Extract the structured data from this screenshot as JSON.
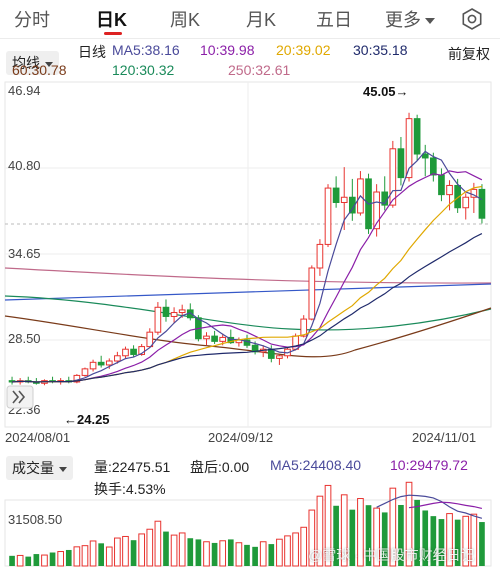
{
  "tabs": [
    {
      "label": "分时",
      "active": false
    },
    {
      "label": "日K",
      "active": true
    },
    {
      "label": "周K",
      "active": false
    },
    {
      "label": "月K",
      "active": false
    },
    {
      "label": "五日",
      "active": false
    },
    {
      "label": "更多",
      "active": false
    }
  ],
  "header": {
    "settings_icon": "settings-gear-icon",
    "indicator_select": "均线",
    "line_type": "日线",
    "adjust_mode": "前复权"
  },
  "moving_averages": [
    {
      "label": "MA5:38.16",
      "color": "#4a4a9a"
    },
    {
      "label": "10:39.98",
      "color": "#8b1fa8"
    },
    {
      "label": "20:39.02",
      "color": "#e0a800"
    },
    {
      "label": "30:35.18",
      "color": "#1f2a6b"
    },
    {
      "label": "60:30.78",
      "color": "#7a3b1a"
    },
    {
      "label": "120:30.32",
      "color": "#1a8a5a"
    },
    {
      "label": "250:32.61",
      "color": "#c06a8a"
    }
  ],
  "price_axis": {
    "ticks": [
      "46.94",
      "40.80",
      "34.65",
      "28.50",
      "22.36"
    ],
    "high_marker": "45.05→",
    "low_marker": "←24.25"
  },
  "date_axis": [
    "2024/08/01",
    "2024/09/12",
    "2024/11/01"
  ],
  "volume_panel": {
    "indicator_select": "成交量",
    "volume": "量:22475.51",
    "after_hours": "盘后:0.00",
    "ma5": "MA5:24408.40",
    "ma10": "10:29479.72",
    "turnover": "换手:4.53%",
    "axis_label": "31508.50"
  },
  "watermark": "@雪球 · 中国股市财经日记",
  "colors": {
    "up": "#e8332f",
    "down": "#1f9a3a",
    "grid": "#e6e6e6",
    "accent": "#d22222"
  },
  "chart_data": {
    "type": "candlestick",
    "ylim": [
      22.36,
      46.94
    ],
    "candles_ohlc": [
      [
        24.6,
        24.9,
        24.3,
        24.5
      ],
      [
        24.5,
        24.8,
        24.3,
        24.6
      ],
      [
        24.6,
        24.9,
        24.4,
        24.5
      ],
      [
        24.5,
        24.8,
        24.3,
        24.4
      ],
      [
        24.4,
        24.7,
        24.25,
        24.6
      ],
      [
        24.6,
        24.9,
        24.4,
        24.5
      ],
      [
        24.5,
        24.8,
        24.3,
        24.6
      ],
      [
        24.6,
        24.9,
        24.4,
        24.5
      ],
      [
        24.5,
        25.1,
        24.4,
        25.0
      ],
      [
        25.0,
        25.6,
        24.9,
        25.5
      ],
      [
        25.5,
        26.2,
        25.3,
        26.0
      ],
      [
        26.0,
        26.5,
        25.6,
        25.8
      ],
      [
        25.8,
        26.3,
        25.5,
        26.1
      ],
      [
        26.1,
        26.8,
        25.9,
        26.5
      ],
      [
        26.5,
        27.2,
        26.3,
        27.0
      ],
      [
        27.0,
        27.3,
        26.4,
        26.6
      ],
      [
        26.6,
        27.4,
        26.5,
        27.2
      ],
      [
        27.2,
        28.6,
        27.1,
        28.3
      ],
      [
        28.3,
        30.6,
        28.1,
        30.2
      ],
      [
        30.2,
        30.8,
        29.1,
        29.5
      ],
      [
        29.5,
        30.2,
        29.0,
        29.8
      ],
      [
        29.8,
        30.4,
        29.4,
        30.0
      ],
      [
        30.0,
        30.5,
        29.2,
        29.4
      ],
      [
        29.4,
        29.6,
        27.6,
        27.8
      ],
      [
        27.8,
        28.3,
        27.3,
        28.0
      ],
      [
        28.0,
        28.4,
        27.4,
        27.6
      ],
      [
        27.6,
        28.2,
        27.3,
        27.9
      ],
      [
        27.9,
        28.5,
        27.4,
        27.5
      ],
      [
        27.5,
        27.9,
        27.2,
        27.7
      ],
      [
        27.7,
        28.1,
        27.1,
        27.3
      ],
      [
        27.3,
        27.6,
        26.6,
        26.8
      ],
      [
        26.8,
        27.3,
        26.4,
        27.0
      ],
      [
        27.0,
        27.3,
        26.0,
        26.3
      ],
      [
        26.3,
        26.6,
        25.8,
        26.5
      ],
      [
        26.5,
        27.2,
        26.3,
        27.0
      ],
      [
        27.0,
        28.2,
        26.9,
        28.0
      ],
      [
        28.0,
        29.6,
        27.9,
        29.3
      ],
      [
        29.3,
        33.4,
        29.2,
        33.2
      ],
      [
        33.2,
        35.4,
        32.6,
        35.0
      ],
      [
        35.0,
        39.6,
        34.8,
        39.3
      ],
      [
        39.3,
        40.2,
        37.8,
        38.2
      ],
      [
        38.2,
        40.9,
        36.1,
        38.6
      ],
      [
        38.6,
        40.0,
        36.8,
        37.4
      ],
      [
        37.4,
        40.6,
        37.2,
        40.0
      ],
      [
        40.0,
        40.4,
        35.8,
        36.2
      ],
      [
        36.2,
        39.6,
        35.6,
        39.0
      ],
      [
        39.0,
        40.2,
        37.6,
        38.0
      ],
      [
        38.0,
        42.9,
        37.8,
        42.3
      ],
      [
        42.3,
        43.2,
        39.5,
        40.1
      ],
      [
        40.1,
        45.05,
        39.8,
        44.6
      ],
      [
        44.6,
        44.9,
        41.4,
        41.9
      ],
      [
        41.9,
        42.6,
        40.2,
        41.6
      ],
      [
        41.6,
        42.0,
        39.8,
        40.3
      ],
      [
        40.3,
        40.8,
        38.3,
        38.8
      ],
      [
        38.8,
        39.9,
        37.6,
        39.5
      ],
      [
        39.5,
        40.0,
        37.4,
        37.8
      ],
      [
        37.8,
        38.9,
        36.9,
        38.6
      ],
      [
        38.6,
        39.7,
        37.4,
        39.2
      ],
      [
        39.2,
        39.6,
        36.6,
        37.0
      ]
    ],
    "volume_values": [
      5200,
      5400,
      4800,
      6100,
      5600,
      6900,
      7400,
      8200,
      9800,
      10400,
      12800,
      11600,
      9700,
      14300,
      15100,
      13200,
      16400,
      18800,
      22900,
      17600,
      15800,
      16900,
      14200,
      13600,
      12400,
      11800,
      12900,
      13600,
      11900,
      10800,
      9800,
      12400,
      11200,
      13700,
      15400,
      16900,
      19800,
      28600,
      35700,
      41200,
      30800,
      36400,
      28800,
      34500,
      31100,
      29600,
      27400,
      39800,
      31200,
      42800,
      33800,
      28400,
      25500,
      24000,
      26800,
      23700,
      25400,
      26500,
      22475.51
    ],
    "volume_ma5": [
      30000,
      32000,
      34000,
      35500,
      36200,
      36000,
      35600,
      34800,
      33000,
      30200,
      28000,
      27100,
      25600,
      24408.4
    ],
    "volume_ma10": [
      29800,
      30400,
      31200,
      32000,
      32600,
      32400,
      31800,
      31000,
      30400,
      29479.72
    ]
  }
}
